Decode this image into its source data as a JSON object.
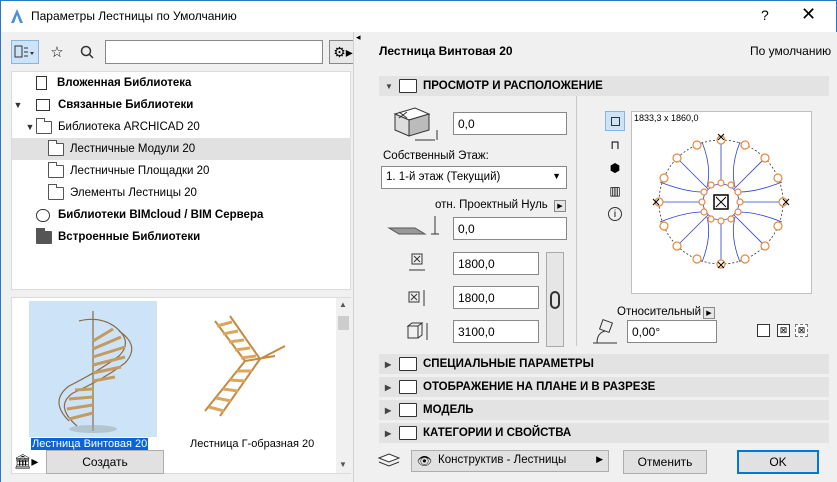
{
  "window": {
    "title": "Параметры Лестницы по Умолчанию",
    "help": "?",
    "close": "✕"
  },
  "library_tree": [
    {
      "label": "Вложенная Библиотека",
      "bold": true
    },
    {
      "label": "Связанные Библиотеки",
      "bold": true,
      "expanded": true
    },
    {
      "label": "Библиотека ARCHICAD 20",
      "bold": false,
      "expanded": true
    },
    {
      "label": "Лестничные Модули 20",
      "bold": false,
      "selected": true
    },
    {
      "label": "Лестничные Площадки 20",
      "bold": false
    },
    {
      "label": "Элементы Лестницы 20",
      "bold": false
    },
    {
      "label": "Библиотеки BIMcloud / BIM Сервера",
      "bold": true
    },
    {
      "label": "Встроенные Библиотеки",
      "bold": true
    }
  ],
  "previews": [
    {
      "label": "Лестница Винтовая 20",
      "selected": true
    },
    {
      "label": "Лестница Г-образная 20",
      "selected": false
    }
  ],
  "left_footer": {
    "create": "Создать"
  },
  "right": {
    "title": "Лестница Винтовая 20",
    "default_label": "По умолчанию",
    "sections": {
      "placement": "ПРОСМОТР И РАСПОЛОЖЕНИЕ",
      "special": "СПЕЦИАЛЬНЫЕ ПАРАМЕТРЫ",
      "plan_section": "ОТОБРАЖЕНИЕ НА ПЛАНЕ И В РАЗРЕЗЕ",
      "model": "МОДЕЛЬ",
      "categories": "КАТЕГОРИИ И СВОЙСТВА"
    },
    "offset_top": "0,0",
    "home_story_label": "Собственный Этаж:",
    "home_story": "1. 1-й этаж (Текущий)",
    "relative_to_label": "отн. Проектный Нуль",
    "offset_base": "0,0",
    "width_x": "1800,0",
    "width_y": "1800,0",
    "height": "3100,0",
    "plan_dims": "1833,3 x 1860,0",
    "relative_label": "Относительный",
    "angle": "0,00°"
  },
  "footer": {
    "layer": "Конструктив - Лестницы",
    "cancel": "Отменить",
    "ok": "OK"
  },
  "colors": {
    "accent": "#0078d7",
    "selection": "#cde3f7",
    "stair_orange": "#e8883a",
    "stair_blue": "#2b3fd6"
  }
}
